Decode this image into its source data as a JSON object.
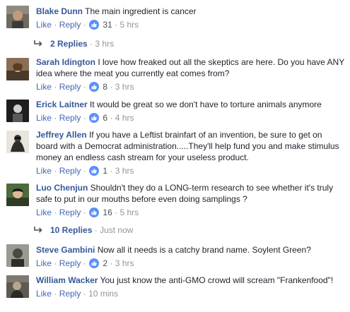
{
  "comments": [
    {
      "author": "Blake Dunn",
      "text": "The main ingredient is cancer",
      "like": "Like",
      "reply": "Reply",
      "reactions": "31",
      "time": "5 hrs",
      "replies_label": "2 Replies",
      "replies_time": "3 hrs"
    },
    {
      "author": "Sarah Idington",
      "text": "I love how freaked out all the skeptics are here. Do you have ANY idea where the meat you currently eat comes from?",
      "like": "Like",
      "reply": "Reply",
      "reactions": "8",
      "time": "3 hrs"
    },
    {
      "author": "Erick Laitner",
      "text": "It would be great so we don't have to torture animals anymore",
      "like": "Like",
      "reply": "Reply",
      "reactions": "6",
      "time": "4 hrs"
    },
    {
      "author": "Jeffrey Allen",
      "text": "If you have a Leftist brainfart of an invention, be sure to get on board with a Democrat administration.....They'll help fund you and make stimulus money an endless cash stream for your useless product.",
      "like": "Like",
      "reply": "Reply",
      "reactions": "1",
      "time": "3 hrs"
    },
    {
      "author": "Luo Chenjun",
      "text": "Shouldn't they do a LONG-term research to see whether it's truly safe to put in our mouths before even doing samplings ?",
      "like": "Like",
      "reply": "Reply",
      "reactions": "16",
      "time": "5 hrs",
      "replies_label": "10 Replies",
      "replies_time": "Just now"
    },
    {
      "author": "Steve Gambini",
      "text": "Now all it needs is a catchy brand name. Soylent Green?",
      "like": "Like",
      "reply": "Reply",
      "reactions": "2",
      "time": "3 hrs"
    },
    {
      "author": "William Wacker",
      "text": "You just know the anti-GMO crowd will scream \"Frankenfood\"!",
      "like": "Like",
      "reply": "Reply",
      "time": "10 mins"
    }
  ],
  "colors": {
    "author": "#365899",
    "link": "#4267b2",
    "meta": "#90949c",
    "like_badge": "#5890ff"
  },
  "icons": {
    "reaction": "thumbs-up-icon",
    "replies": "reply-arrow-icon"
  }
}
